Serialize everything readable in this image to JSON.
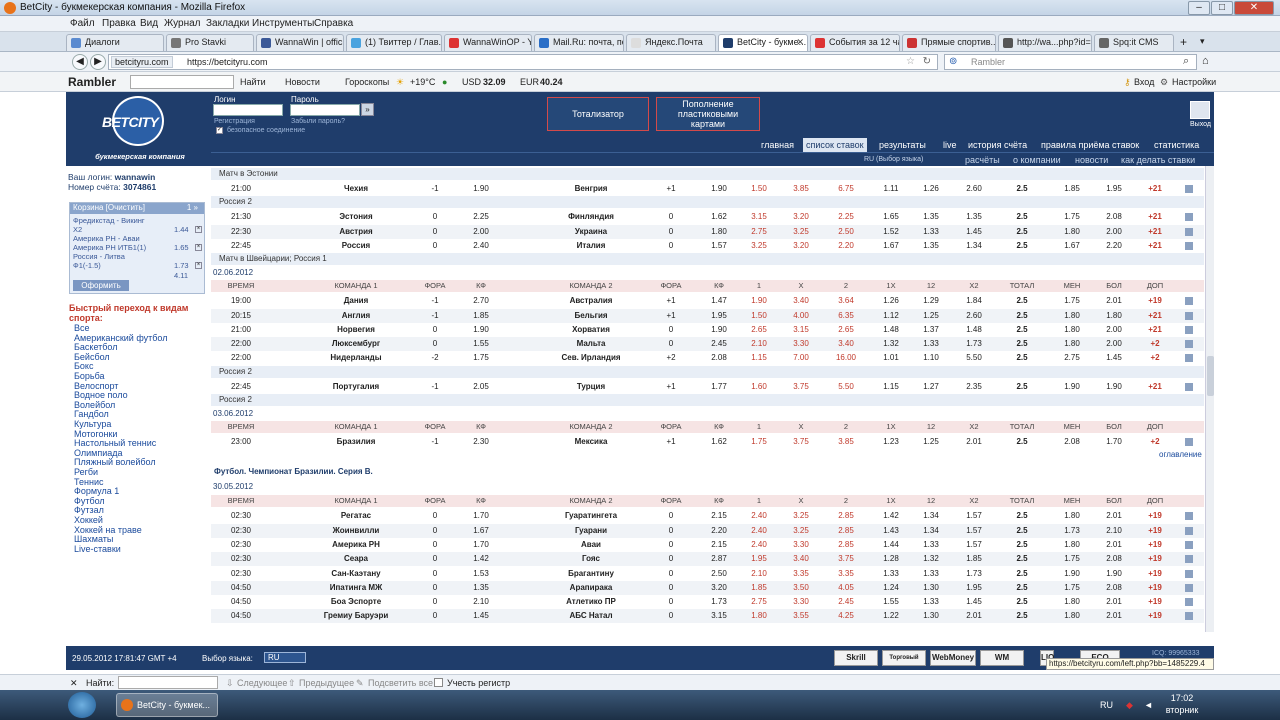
{
  "window": {
    "title": "BetCity - букмекерская компания - Mozilla Firefox"
  },
  "menu": [
    "Файл",
    "Правка",
    "Вид",
    "Журнал",
    "Закладки",
    "Инструменты",
    "Справка"
  ],
  "tabs": [
    "Диалоги",
    "Pro Stavki",
    "WannaWin | officia...",
    "(1) Твиттер / Глав...",
    "WannaWinOP - Yo...",
    "Mail.Ru: почта, по...",
    "Яндекс.Почта",
    "BetCity - букме...",
    "События за 12 час...",
    "Прямые спортив...",
    "http://wa...php?id=7",
    "Spq:it CMS"
  ],
  "nav": {
    "site": "betcityru.com",
    "url": "https://betcityru.com",
    "search_placeholder": "Rambler"
  },
  "rambler": {
    "logo": "Rambler",
    "find": "Найти",
    "news": "Новости",
    "horoscopes": "Гороскопы",
    "temp": "+19°C",
    "usd_label": "USD",
    "usd": "32.09",
    "eur_label": "EUR",
    "eur": "40.24",
    "login": "Вход",
    "settings": "Настройки"
  },
  "header": {
    "logo": "BETCITY",
    "logo_sub": "букмекерская компания",
    "login_label": "Логин",
    "password_label": "Пароль",
    "register": "Регистрация",
    "forgot": "Забыли пароль?",
    "safe": "безопасное соединение",
    "totalizator": "Тотализатор",
    "topup": "Пополнение пластиковыми картами",
    "exit": "Выход"
  },
  "navrow1": [
    "главная",
    "список ставок",
    "результаты",
    "live",
    "история счёта",
    "правила приёма ставок",
    "статистика"
  ],
  "navrow2": {
    "lang": "RU (Выбор языка)",
    "items": [
      "расчёты",
      "о компании",
      "новости",
      "как делать ставки"
    ]
  },
  "left": {
    "login_prefix": "Ваш логин:",
    "login": "wannawin",
    "acct_prefix": "Номер счёта:",
    "acct": "3074861",
    "basket_title": "Корзина [Очистить]",
    "basket_count": "1 »",
    "bets": [
      {
        "t": "Фредикстад - Викинг",
        "o": ""
      },
      {
        "t": "X2",
        "o": "1.44"
      },
      {
        "t": "Америка РН - Аваи",
        "o": ""
      },
      {
        "t": "Америка РН ИТБ1(1)",
        "o": "1.65"
      },
      {
        "t": "Россия - Литва",
        "o": ""
      },
      {
        "t": "Ф1(-1.5)",
        "o": "1.73"
      }
    ],
    "total": "4.11",
    "checkout": "Оформить",
    "quick": "Быстрый переход к видам спорта:",
    "sports": [
      "Все",
      "Американский футбол",
      "Баскетбол",
      "Бейсбол",
      "Бокс",
      "Борьба",
      "Велоспорт",
      "Водное поло",
      "Волейбол",
      "Гандбол",
      "Культура",
      "Мотогонки",
      "Настольный теннис",
      "Олимпиада",
      "Пляжный волейбол",
      "Регби",
      "Теннис",
      "Формула 1",
      "Футбол",
      "Футзал",
      "Хоккей",
      "Хоккей на траве",
      "Шахматы",
      "Live-ставки"
    ]
  },
  "cols": [
    "ВРЕМЯ",
    "КОМАНДА 1",
    "ФОРА",
    "КФ",
    "КОМАНДА 2",
    "ФОРА",
    "КФ",
    "1",
    "X",
    "2",
    "1X",
    "12",
    "X2",
    "ТОТАЛ",
    "МЕН",
    "БОЛ",
    "ДОП"
  ],
  "sections": [
    {
      "group": "Матч в Эстонии",
      "rows": [
        [
          "21:00",
          "Чехия",
          "-1",
          "1.90",
          "Венгрия",
          "+1",
          "1.90",
          "1.50",
          "3.85",
          "6.75",
          "1.11",
          "1.26",
          "2.60",
          "2.5",
          "1.85",
          "1.95",
          "+21"
        ]
      ]
    },
    {
      "group": "Россия 2",
      "rows": [
        [
          "21:30",
          "Эстония",
          "0",
          "2.25",
          "Финляндия",
          "0",
          "1.62",
          "3.15",
          "3.20",
          "2.25",
          "1.65",
          "1.35",
          "1.35",
          "2.5",
          "1.75",
          "2.08",
          "+21"
        ],
        [
          "22:30",
          "Австрия",
          "0",
          "2.00",
          "Украина",
          "0",
          "1.80",
          "2.75",
          "3.25",
          "2.50",
          "1.52",
          "1.33",
          "1.45",
          "2.5",
          "1.80",
          "2.00",
          "+21"
        ],
        [
          "22:45",
          "Россия",
          "0",
          "2.40",
          "Италия",
          "0",
          "1.57",
          "3.25",
          "3.20",
          "2.20",
          "1.67",
          "1.35",
          "1.34",
          "2.5",
          "1.67",
          "2.20",
          "+21"
        ]
      ]
    },
    {
      "group": "Матч в Швейцарии; Россия 1",
      "date": "02.06.2012",
      "header": true,
      "rows": [
        [
          "19:00",
          "Дания",
          "-1",
          "2.70",
          "Австралия",
          "+1",
          "1.47",
          "1.90",
          "3.40",
          "3.64",
          "1.26",
          "1.29",
          "1.84",
          "2.5",
          "1.75",
          "2.01",
          "+19"
        ],
        [
          "20:15",
          "Англия",
          "-1",
          "1.85",
          "Бельгия",
          "+1",
          "1.95",
          "1.50",
          "4.00",
          "6.35",
          "1.12",
          "1.25",
          "2.60",
          "2.5",
          "1.80",
          "1.80",
          "+21"
        ],
        [
          "21:00",
          "Норвегия",
          "0",
          "1.90",
          "Хорватия",
          "0",
          "1.90",
          "2.65",
          "3.15",
          "2.65",
          "1.48",
          "1.37",
          "1.48",
          "2.5",
          "1.80",
          "2.00",
          "+21"
        ],
        [
          "22:00",
          "Люксембург",
          "0",
          "1.55",
          "Мальта",
          "0",
          "2.45",
          "2.10",
          "3.30",
          "3.40",
          "1.32",
          "1.33",
          "1.73",
          "2.5",
          "1.80",
          "2.00",
          "+2"
        ],
        [
          "22:00",
          "Нидерланды",
          "-2",
          "1.75",
          "Сев. Ирландия",
          "+2",
          "2.08",
          "1.15",
          "7.00",
          "16.00",
          "1.01",
          "1.10",
          "5.50",
          "2.5",
          "2.75",
          "1.45",
          "+2"
        ]
      ]
    },
    {
      "group": "Россия 2",
      "rows": [
        [
          "22:45",
          "Португалия",
          "-1",
          "2.05",
          "Турция",
          "+1",
          "1.77",
          "1.60",
          "3.75",
          "5.50",
          "1.15",
          "1.27",
          "2.35",
          "2.5",
          "1.90",
          "1.90",
          "+21"
        ]
      ]
    },
    {
      "group": "Россия 2",
      "date": "03.06.2012",
      "header": true,
      "rows": [
        [
          "23:00",
          "Бразилия",
          "-1",
          "2.30",
          "Мексика",
          "+1",
          "1.62",
          "1.75",
          "3.75",
          "3.85",
          "1.23",
          "1.25",
          "2.01",
          "2.5",
          "2.08",
          "1.70",
          "+2"
        ]
      ]
    }
  ],
  "toc": "оглавление",
  "brazil": {
    "league": "Футбол. Чемпионат Бразилии. Серия В.",
    "date": "30.05.2012",
    "rows": [
      [
        "02:30",
        "Регатас",
        "0",
        "1.70",
        "Гуаратингета",
        "0",
        "2.15",
        "2.40",
        "3.25",
        "2.85",
        "1.42",
        "1.34",
        "1.57",
        "2.5",
        "1.80",
        "2.01",
        "+19"
      ],
      [
        "02:30",
        "Жоинвилли",
        "0",
        "1.67",
        "Гуарани",
        "0",
        "2.20",
        "2.40",
        "3.25",
        "2.85",
        "1.43",
        "1.34",
        "1.57",
        "2.5",
        "1.73",
        "2.10",
        "+19"
      ],
      [
        "02:30",
        "Америка РН",
        "0",
        "1.70",
        "Аваи",
        "0",
        "2.15",
        "2.40",
        "3.30",
        "2.85",
        "1.44",
        "1.33",
        "1.57",
        "2.5",
        "1.80",
        "2.01",
        "+19"
      ],
      [
        "02:30",
        "Сеара",
        "0",
        "1.42",
        "Гояс",
        "0",
        "2.87",
        "1.95",
        "3.40",
        "3.75",
        "1.28",
        "1.32",
        "1.85",
        "2.5",
        "1.75",
        "2.08",
        "+19"
      ],
      [
        "02:30",
        "Сан-Каэтану",
        "0",
        "1.53",
        "Брагантину",
        "0",
        "2.50",
        "2.10",
        "3.35",
        "3.35",
        "1.33",
        "1.33",
        "1.73",
        "2.5",
        "1.90",
        "1.90",
        "+19"
      ],
      [
        "04:50",
        "Ипатинга МЖ",
        "0",
        "1.35",
        "Арапирака",
        "0",
        "3.20",
        "1.85",
        "3.50",
        "4.05",
        "1.24",
        "1.30",
        "1.95",
        "2.5",
        "1.75",
        "2.08",
        "+19"
      ],
      [
        "04:50",
        "Боа Эспорте",
        "0",
        "2.10",
        "Атлетико ПР",
        "0",
        "1.73",
        "2.75",
        "3.30",
        "2.45",
        "1.55",
        "1.33",
        "1.45",
        "2.5",
        "1.80",
        "2.01",
        "+19"
      ],
      [
        "04:50",
        "Гремиу Баруэри",
        "0",
        "1.45",
        "АБС Натал",
        "0",
        "3.15",
        "1.80",
        "3.55",
        "4.25",
        "1.22",
        "1.30",
        "2.01",
        "2.5",
        "1.80",
        "2.01",
        "+19"
      ]
    ]
  },
  "footer": {
    "datetime": "29.05.2012 17:81:47 GMT +4",
    "lang_label": "Выбор языка:",
    "lang": "RU",
    "banners": [
      "Skrill",
      "Торговый",
      "WebMoney",
      "WM",
      "LIQ",
      "ECO"
    ],
    "ico": "ICQ: 99965333"
  },
  "status": "https://betcityru.com/left.php?bb=1485229.4",
  "findbar": {
    "label": "Найти:",
    "next": "Следующее",
    "prev": "Предыдущее",
    "highlight": "Подсветить все",
    "case": "Учесть регистр"
  },
  "taskbar": {
    "task": "BetCity - букмек...",
    "lang": "RU",
    "time": "17:02",
    "day": "вторник"
  }
}
